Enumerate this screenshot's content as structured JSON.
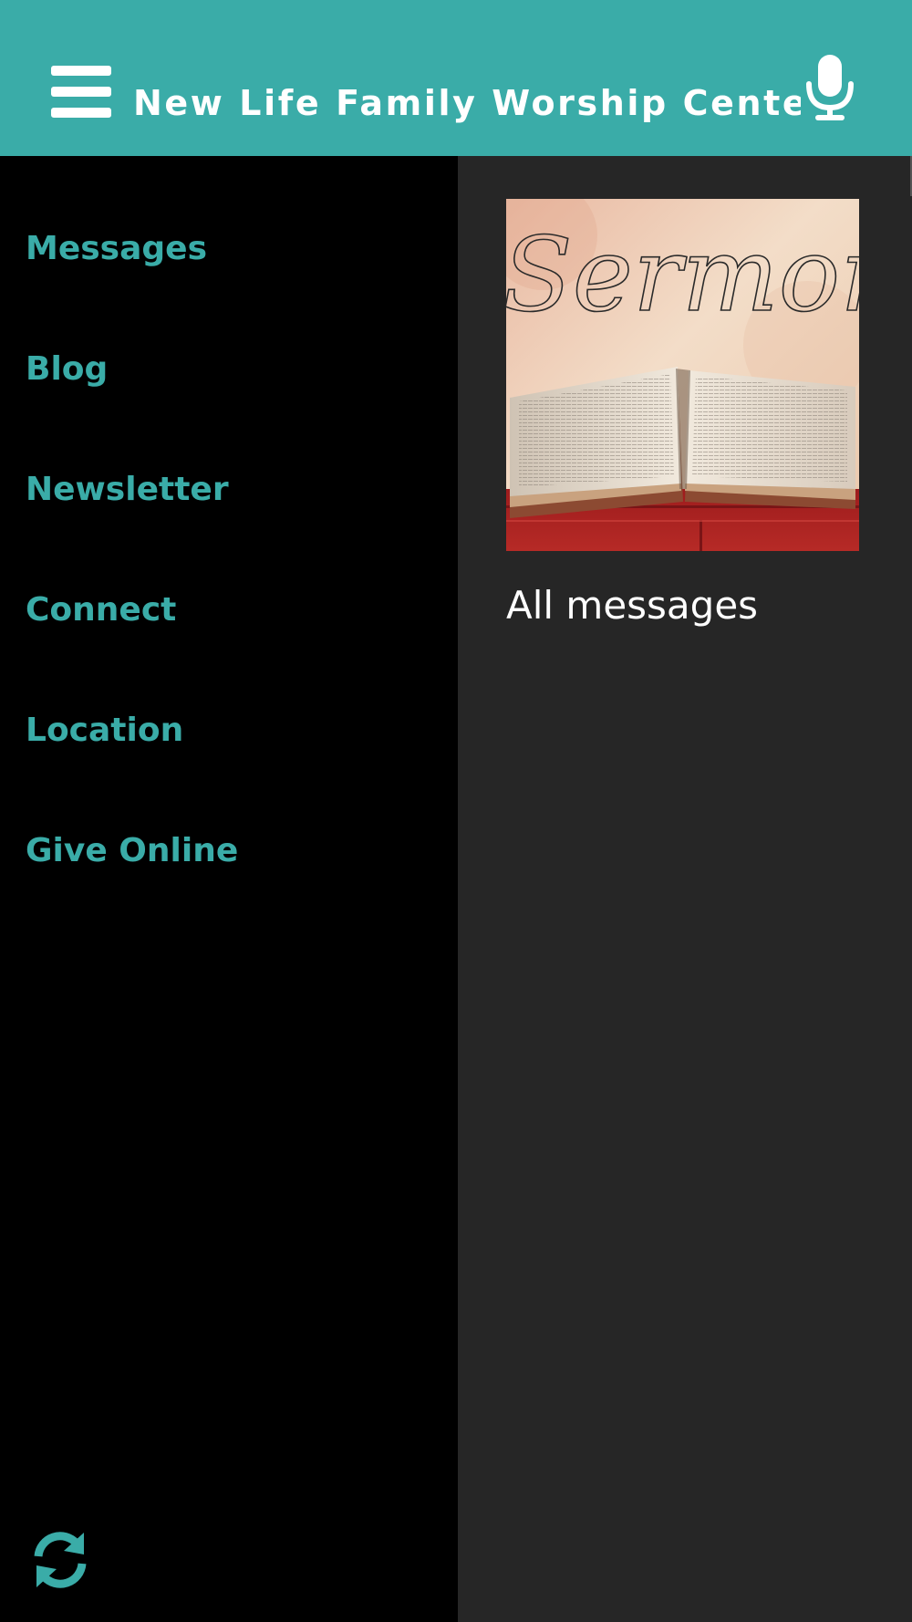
{
  "header": {
    "title": "New Life Family Worship Center",
    "menu_icon": "hamburger-menu-icon",
    "mic_icon": "microphone-icon",
    "background_color": "#3aaca8"
  },
  "sidebar": {
    "items": [
      {
        "label": "Messages"
      },
      {
        "label": "Blog"
      },
      {
        "label": "Newsletter"
      },
      {
        "label": "Connect"
      },
      {
        "label": "Location"
      },
      {
        "label": "Give Online"
      }
    ],
    "refresh_icon": "refresh-icon",
    "accent_color": "#3aaca8"
  },
  "content": {
    "card": {
      "image_text": "Sermon",
      "label": "All messages"
    }
  }
}
